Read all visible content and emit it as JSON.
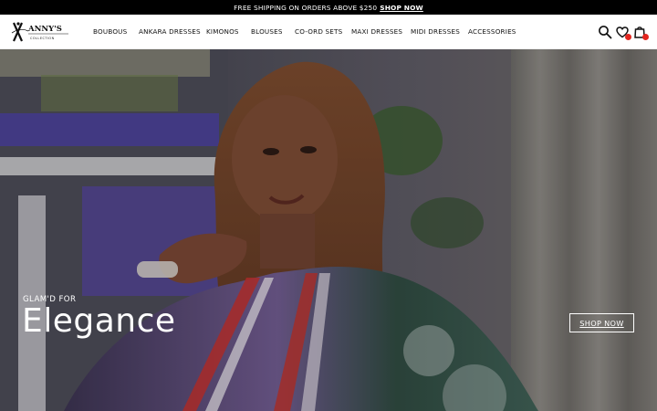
{
  "announcement": {
    "text": "FREE SHIPPING ON ORDERS ABOVE $250",
    "link": "SHOP NOW"
  },
  "brand": {
    "name": "ANNY'S",
    "tagline": "COLLECTION"
  },
  "nav": {
    "items": [
      {
        "label": "BOUBOUS"
      },
      {
        "label": "ANKARA DRESSES"
      },
      {
        "label": "KIMONOS"
      },
      {
        "label": "BLOUSES"
      },
      {
        "label": "CO-ORD SETS"
      },
      {
        "label": "MAXI DRESSES"
      },
      {
        "label": "MIDI DRESSES"
      },
      {
        "label": "ACCESSORIES"
      }
    ]
  },
  "icons": {
    "search": "search-icon",
    "wishlist": "heart-icon",
    "cart": "shopping-bag-icon",
    "badge_color": "#e3261f"
  },
  "hero": {
    "eyebrow": "GLAM'D FOR",
    "title": "Elegance",
    "cta": "SHOP NOW"
  }
}
